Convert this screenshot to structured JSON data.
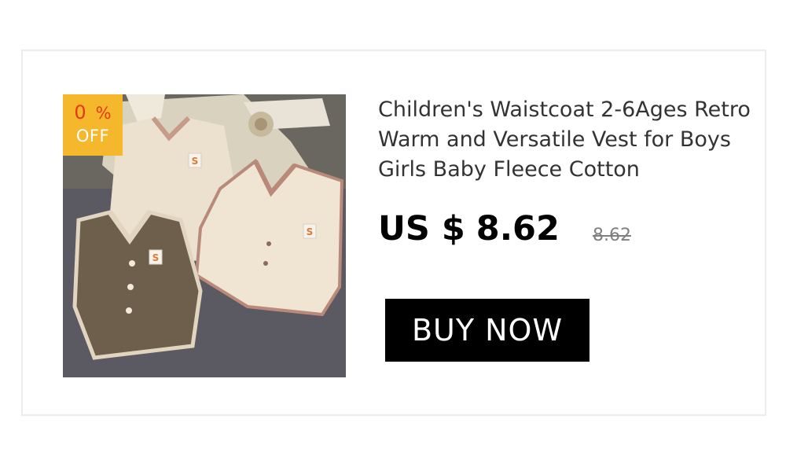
{
  "badge": {
    "value": "0",
    "percent": "%",
    "off_label": "OFF"
  },
  "product": {
    "title": "Children's Waistcoat 2-6Ages Retro Warm and Versatile Vest for Boys Girls Baby Fleece Cotton",
    "image_alt": "Children's fleece vests photo",
    "patch_letter": "S"
  },
  "price": {
    "currency": "US $",
    "amount": "8.62",
    "original": "8.62"
  },
  "cta": {
    "label": "BUY NOW"
  },
  "colors": {
    "badge_bg": "#f5b72c",
    "badge_number": "#e23a12",
    "button_bg": "#000000",
    "strikethrough": "#808080"
  }
}
